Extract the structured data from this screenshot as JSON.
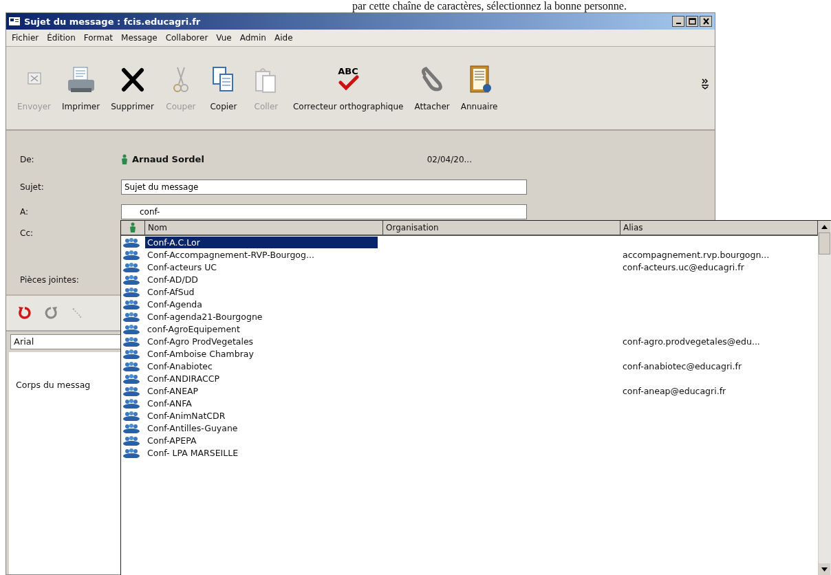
{
  "background_text": "par cette chaîne de caractères, sélectionnez la bonne personne.",
  "window": {
    "title": "Sujet du message : fcis.educagri.fr"
  },
  "menu": [
    "Fichier",
    "Édition",
    "Format",
    "Message",
    "Collaborer",
    "Vue",
    "Admin",
    "Aide"
  ],
  "toolbar": [
    {
      "kind": "send",
      "label": "Envoyer",
      "disabled": true
    },
    {
      "kind": "print",
      "label": "Imprimer",
      "disabled": false
    },
    {
      "kind": "delete",
      "label": "Supprimer",
      "disabled": false
    },
    {
      "kind": "cut",
      "label": "Couper",
      "disabled": true
    },
    {
      "kind": "copy",
      "label": "Copier",
      "disabled": false
    },
    {
      "kind": "paste",
      "label": "Coller",
      "disabled": true
    },
    {
      "kind": "spell",
      "label": "Correcteur orthographique",
      "icon_text": "ABC",
      "disabled": false
    },
    {
      "kind": "attach",
      "label": "Attacher",
      "disabled": false
    },
    {
      "kind": "book",
      "label": "Annuaire",
      "disabled": false
    }
  ],
  "header": {
    "from_label": "De:",
    "from": "Arnaud Sordel",
    "date": "02/04/20...",
    "subject_label": "Sujet:",
    "subject": "Sujet du message",
    "to_label": "A:",
    "to": "conf-",
    "cc_label": "Cc:",
    "attachments_label": "Pièces jointes:"
  },
  "editor": {
    "font": "Arial",
    "body": "Corps du messag"
  },
  "suggestions": {
    "columns": [
      "Nom",
      "Organisation",
      "Alias"
    ],
    "rows": [
      {
        "name": "Conf-A.C.Lor",
        "alias": "",
        "selected": true
      },
      {
        "name": "Conf-Accompagnement-RVP-Bourgog...",
        "alias": "accompagnement.rvp.bourgogn...",
        "selected": false
      },
      {
        "name": "Conf-acteurs UC",
        "alias": "conf-acteurs.uc@educagri.fr",
        "selected": false
      },
      {
        "name": "Conf-AD/DD",
        "alias": "",
        "selected": false
      },
      {
        "name": "Conf-AfSud",
        "alias": "",
        "selected": false
      },
      {
        "name": "Conf-Agenda",
        "alias": "",
        "selected": false
      },
      {
        "name": "Conf-agenda21-Bourgogne",
        "alias": "",
        "selected": false
      },
      {
        "name": "conf-AgroEquipement",
        "alias": "",
        "selected": false
      },
      {
        "name": "Conf-Agro ProdVegetales",
        "alias": "conf-agro.prodvegetales@edu...",
        "selected": false
      },
      {
        "name": "Conf-Amboise Chambray",
        "alias": "",
        "selected": false
      },
      {
        "name": "Conf-Anabiotec",
        "alias": "conf-anabiotec@educagri.fr",
        "selected": false
      },
      {
        "name": "Conf-ANDIRACCP",
        "alias": "",
        "selected": false
      },
      {
        "name": "Conf-ANEAP",
        "alias": "conf-aneap@educagri.fr",
        "selected": false
      },
      {
        "name": "Conf-ANFA",
        "alias": "",
        "selected": false
      },
      {
        "name": "Conf-AnimNatCDR",
        "alias": "",
        "selected": false
      },
      {
        "name": "Conf-Antilles-Guyane",
        "alias": "",
        "selected": false
      },
      {
        "name": "Conf-APEPA",
        "alias": "",
        "selected": false
      },
      {
        "name": "Conf- LPA MARSEILLE",
        "alias": "",
        "selected": false
      }
    ]
  }
}
